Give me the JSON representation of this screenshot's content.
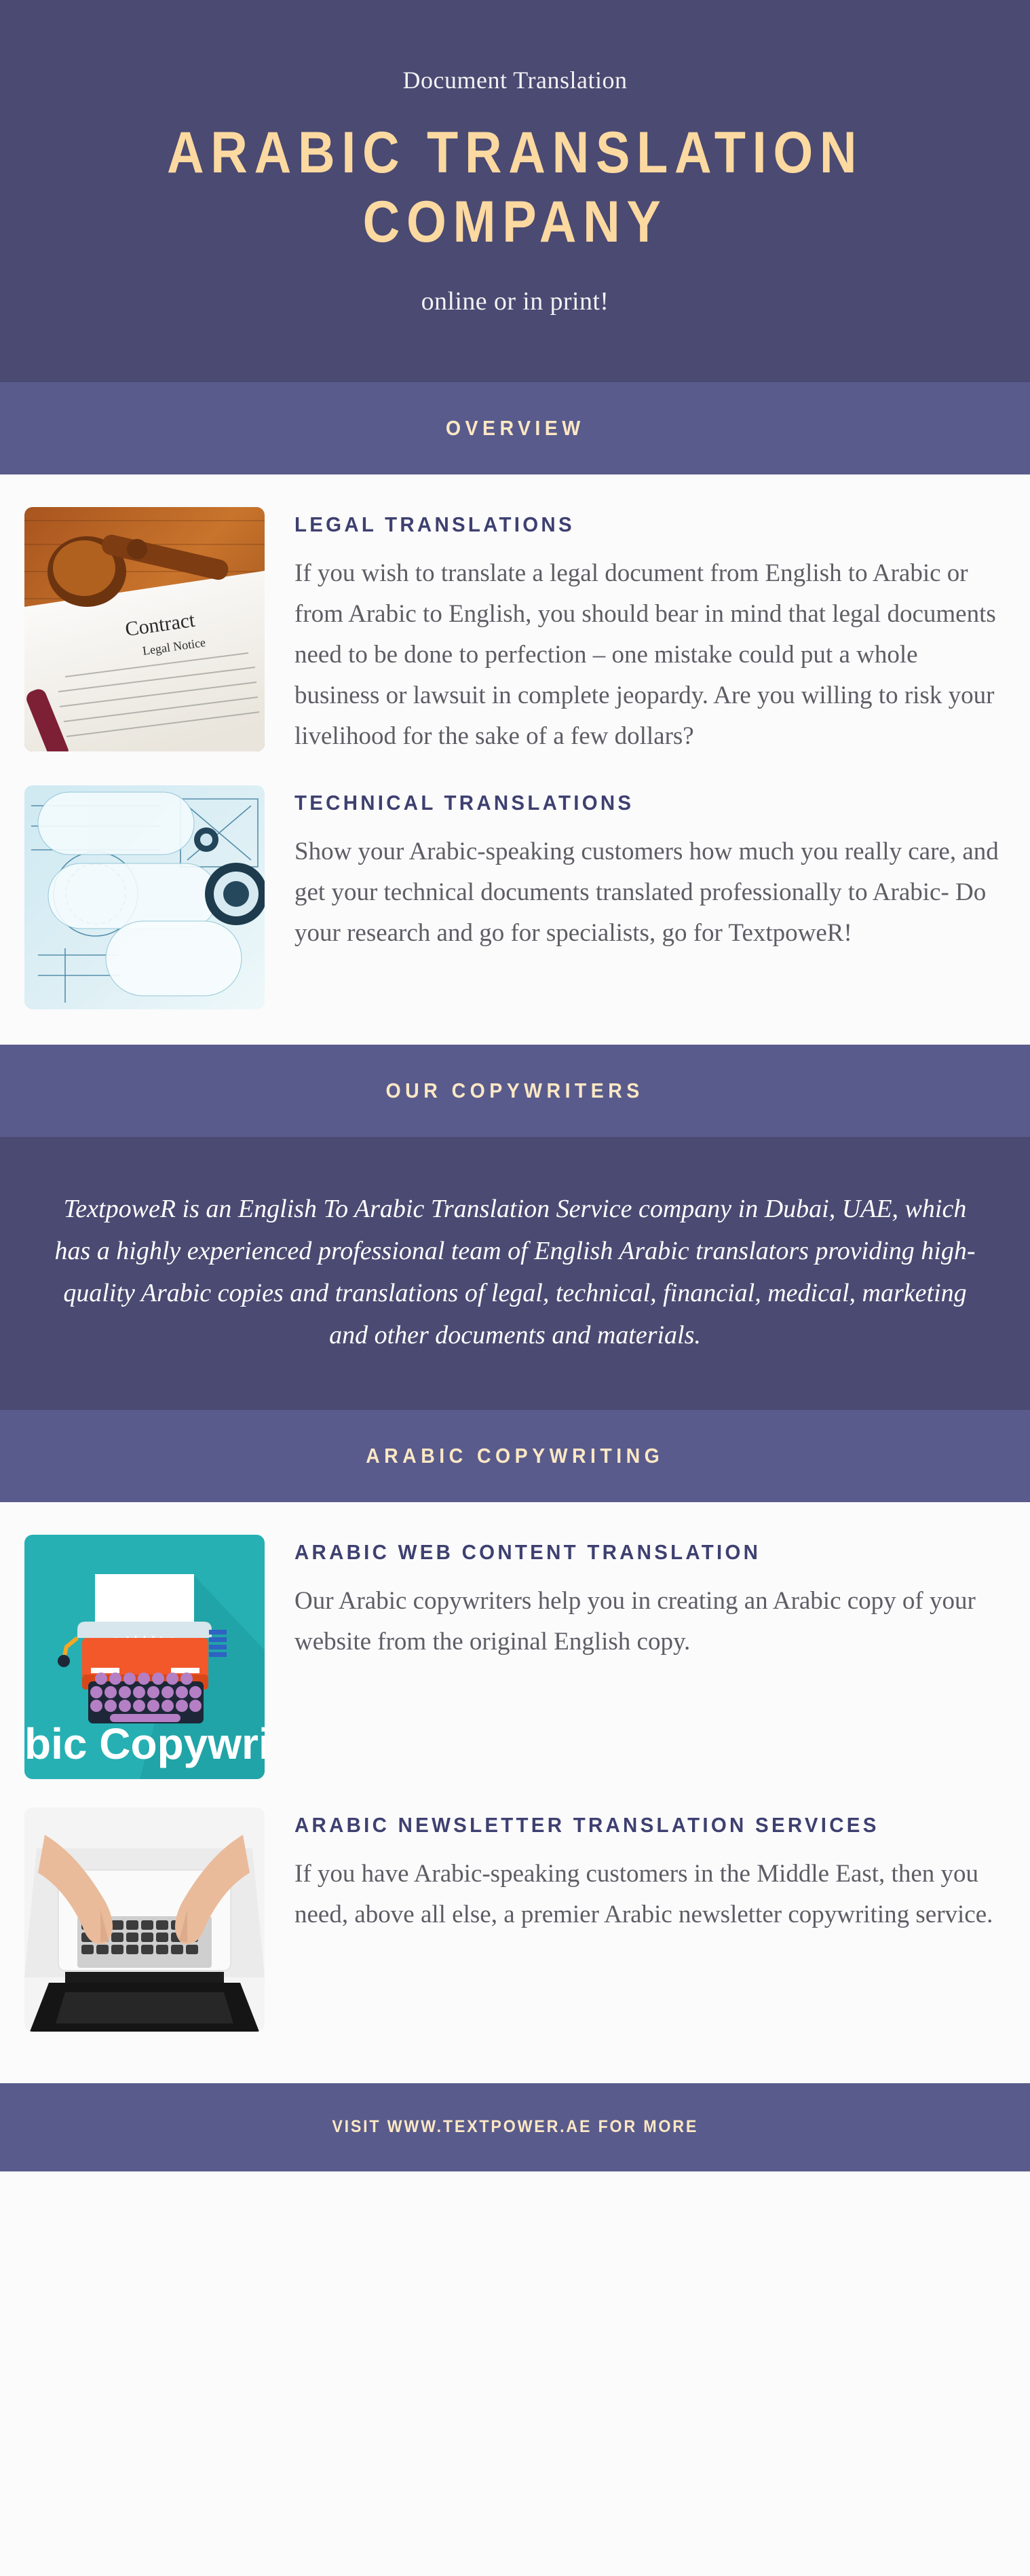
{
  "colors": {
    "hero_bg": "#4a4a72",
    "banner_bg": "#595b8c",
    "accent_cream": "#fcd9a0",
    "heading_navy": "#3e4070",
    "body_gray": "#5d5d64",
    "light_bg": "#fbfbfc"
  },
  "hero": {
    "eyebrow": "Document Translation",
    "title_line_1": "ARABIC TRANSLATION",
    "title_line_2": "COMPANY",
    "subtitle": "online or in print!"
  },
  "sections": [
    {
      "banner_label": "OVERVIEW",
      "items": [
        {
          "heading": "LEGAL TRANSLATIONS",
          "image_name": "gavel-on-contract-photo",
          "image_caption_title": "Contract",
          "image_caption_sub": "Legal Notice",
          "body": "If you wish to translate a legal document from English to Arabic or from Arabic to English, you should bear in mind that legal documents need to be done to perfection – one mistake could put a whole business or lawsuit in complete jeopardy. Are you willing to risk your livelihood for the sake of a few dollars?"
        },
        {
          "heading": "TECHNICAL TRANSLATIONS",
          "image_name": "engineering-blueprints-photo",
          "body": "Show your Arabic-speaking customers how much you really care, and get your technical documents translated professionally to Arabic- Do your research and go for specialists, go for TextpoweR!"
        }
      ]
    }
  ],
  "copywriters": {
    "banner_label": "OUR COPYWRITERS",
    "paragraph": "TextpoweR is an English To Arabic Translation Service company in Dubai, UAE, which has a highly experienced professional team of English Arabic translators providing high-quality Arabic copies and translations of legal, technical, financial, medical, marketing and other documents and materials."
  },
  "copywriting": {
    "banner_label": "ARABIC COPYWRITING",
    "items": [
      {
        "heading": "ARABIC WEB CONTENT TRANSLATION",
        "image_name": "typewriter-flat-illustration",
        "image_text": "bic Copywri",
        "body": "Our Arabic copywriters help you in creating an Arabic copy of your website from the original English copy."
      },
      {
        "heading": "ARABIC NEWSLETTER TRANSLATION SERVICES",
        "image_name": "hands-typing-laptop-photo",
        "body": "If you have Arabic-speaking customers in the Middle East, then you need, above all else, a premier Arabic newsletter copywriting service."
      }
    ]
  },
  "footer": {
    "text": "VISIT WWW.TEXTPOWER.AE  FOR MORE"
  }
}
